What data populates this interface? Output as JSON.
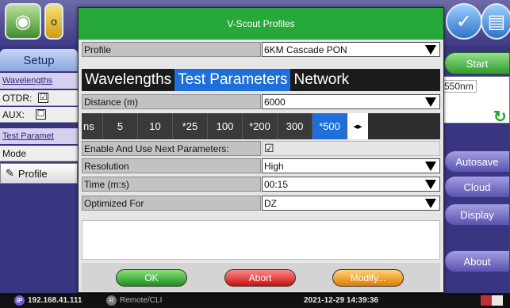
{
  "dialog": {
    "title": "V-Scout Profiles",
    "profile_label": "Profile",
    "profile_value": "6KM Cascade PON",
    "tabs": [
      "Wavelengths",
      "Test Parameters",
      "Network"
    ],
    "active_tab": "Test Parameters",
    "distance_label": "Distance (m)",
    "distance_value": "6000",
    "distance_options": [
      "ns",
      "5",
      "10",
      "*25",
      "100",
      "*200",
      "300",
      "*500"
    ],
    "selected_distance_option": "*500",
    "scroll_glyph": "◂▸",
    "enable_next_label": "Enable And Use Next Parameters:",
    "enable_next_checked": "☑",
    "resolution_label": "Resolution",
    "resolution_value": "High",
    "time_label": "Time (m:s)",
    "time_value": "00:15",
    "optimized_label": "Optimized For",
    "optimized_value": "DZ",
    "buttons": {
      "ok": "OK",
      "abort": "Abort",
      "modify": "Modify..."
    }
  },
  "left_panel": {
    "setup_tab": "Setup",
    "wavelengths_header": "Wavelengths",
    "otdr_label": "OTDR:",
    "otdr_check": "☑",
    "aux_label": "AUX:",
    "aux_check": "☐",
    "test_params_header": "Test Paramet",
    "mode_label": "Mode",
    "profile_button": "Profile"
  },
  "right_panel": {
    "start": "Start",
    "trace_label": "550nm",
    "autosave": "Autosave",
    "cloud": "Cloud",
    "display": "Display",
    "about": "About"
  },
  "statusbar": {
    "ip_badge": "IP",
    "ip": "192.168.41.111",
    "remote_badge": "R",
    "remote": "Remote/CLI",
    "datetime": "2021-12-29  14:39:36"
  },
  "colors": {
    "title_green": "#27a83a",
    "selected_blue": "#1e6fd9"
  }
}
